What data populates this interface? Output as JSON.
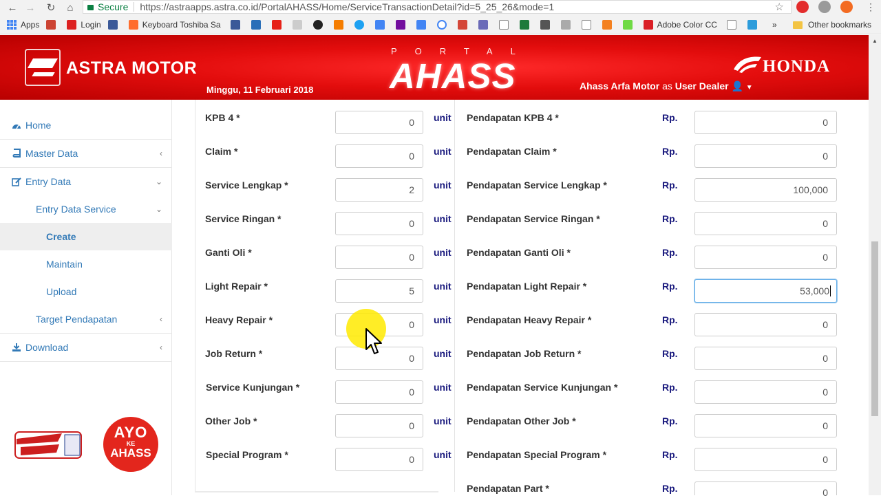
{
  "browser": {
    "secure_label": "Secure",
    "url": "https://astraapps.astra.co.id/PortalAHASS/Home/ServiceTransactionDetail?id=5_25_26&mode=1",
    "bookmarks": [
      {
        "label": "Apps"
      },
      {
        "label": "Login"
      },
      {
        "label": "Keyboard Toshiba Sa"
      },
      {
        "label": "Adobe Color CC"
      }
    ],
    "other_bookmarks": "Other bookmarks"
  },
  "header": {
    "brand": "ASTRA MOTOR",
    "date": "Minggu, 11 Februari 2018",
    "portal": "PORTAL",
    "title": "AHASS",
    "user_name": "Ahass Arfa Motor",
    "user_as": "as",
    "user_role": "User Dealer",
    "honda": "HONDA"
  },
  "sidebar": {
    "items": [
      {
        "label": "Home",
        "icon": "dashboard-icon"
      },
      {
        "label": "Master Data",
        "icon": "book-icon"
      },
      {
        "label": "Entry Data",
        "icon": "edit-icon"
      },
      {
        "label": "Entry Data Service"
      },
      {
        "label": "Create"
      },
      {
        "label": "Maintain"
      },
      {
        "label": "Upload"
      },
      {
        "label": "Target Pendapatan"
      },
      {
        "label": "Download",
        "icon": "download-icon"
      }
    ],
    "ahass_logo": "AHASS JAMINAN KUALITAS SERVIS",
    "ayo_line1": "AYO",
    "ayo_line2": "KE",
    "ayo_line3": "AHASS"
  },
  "form": {
    "unit_label": "unit",
    "rp_label": "Rp.",
    "rows": [
      {
        "label": "KPB 4 *",
        "qty": "0",
        "rev_label": "Pendapatan KPB 4 *",
        "rev": "0"
      },
      {
        "label": "Claim *",
        "qty": "0",
        "rev_label": "Pendapatan Claim *",
        "rev": "0"
      },
      {
        "label": "Service Lengkap *",
        "qty": "2",
        "rev_label": "Pendapatan Service Lengkap *",
        "rev": "100,000"
      },
      {
        "label": "Service Ringan *",
        "qty": "0",
        "rev_label": "Pendapatan Service Ringan *",
        "rev": "0"
      },
      {
        "label": "Ganti Oli *",
        "qty": "0",
        "rev_label": "Pendapatan Ganti Oli *",
        "rev": "0"
      },
      {
        "label": "Light Repair *",
        "qty": "5",
        "rev_label": "Pendapatan Light Repair *",
        "rev": "53,000"
      },
      {
        "label": "Heavy Repair *",
        "qty": "0",
        "rev_label": "Pendapatan Heavy Repair *",
        "rev": "0"
      },
      {
        "label": "Job Return *",
        "qty": "0",
        "rev_label": "Pendapatan Job Return *",
        "rev": "0"
      },
      {
        "label": "Service Kunjungan *",
        "qty": "0",
        "rev_label": "Pendapatan Service Kunjungan *",
        "rev": "0"
      },
      {
        "label": "Other Job *",
        "qty": "0",
        "rev_label": "Pendapatan Other Job *",
        "rev": "0"
      },
      {
        "label": "Special Program *",
        "qty": "0",
        "rev_label": "Pendapatan Special Program *",
        "rev": "0"
      }
    ],
    "extra_rev_label": "Pendapatan Part *",
    "extra_rev": "0"
  },
  "colors": {
    "header_red": "#e30d0d",
    "link_blue": "#337ab7",
    "unit_navy": "#1a1a7e"
  }
}
